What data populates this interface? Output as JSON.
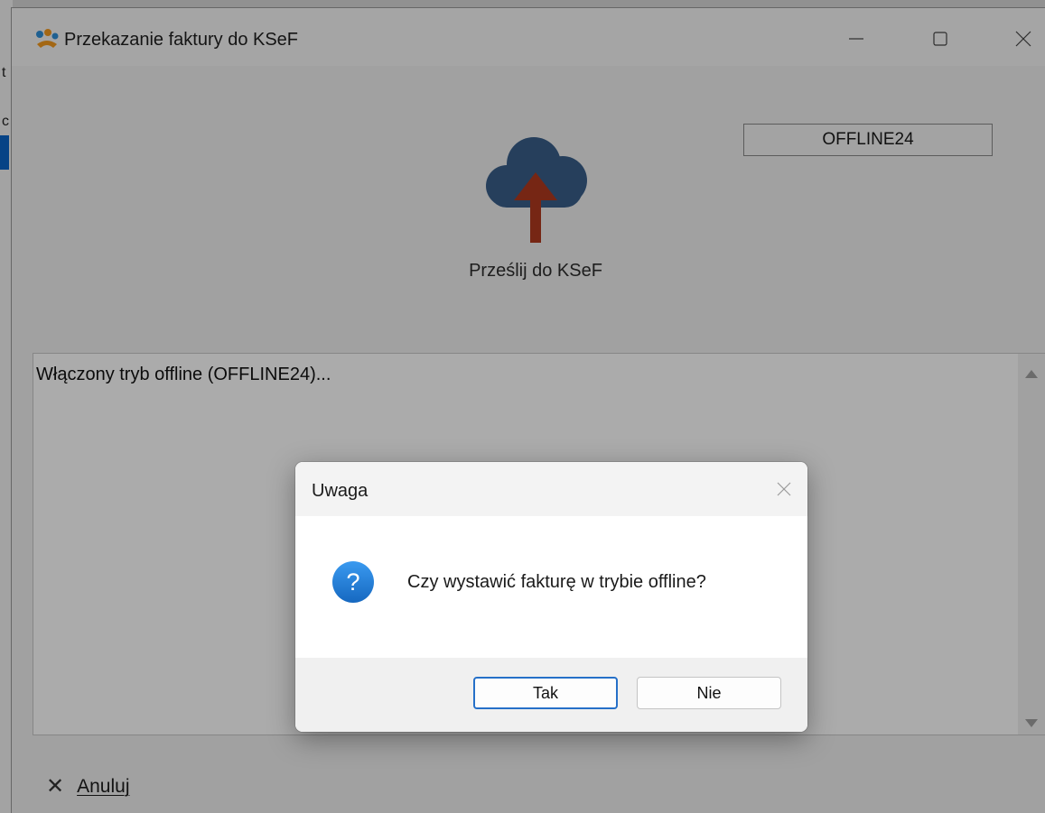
{
  "background_window": {
    "chars": [
      "t",
      "c"
    ]
  },
  "window": {
    "title": "Przekazanie faktury do KSeF",
    "app_icon": "app-logo-icon",
    "controls": {
      "minimize_icon": "minimize-icon",
      "maximize_icon": "maximize-icon",
      "close_icon": "close-icon"
    }
  },
  "mode_badge": "OFFLINE24",
  "upload": {
    "icon": "cloud-upload-icon",
    "label": "Prześlij  do KSeF"
  },
  "log": {
    "text": "Włączony tryb offline (OFFLINE24)..."
  },
  "footer": {
    "cancel_icon": "close-x-icon",
    "cancel_label": "Anuluj"
  },
  "dialog": {
    "title": "Uwaga",
    "icon": "question-icon",
    "message": "Czy wystawić fakturę w trybie offline?",
    "yes_label": "Tak",
    "no_label": "Nie"
  },
  "colors": {
    "cloud": "#3a5f8a",
    "arrow": "#b13a1f",
    "question_icon": "#1f7fd6",
    "default_button_border": "#2670c8"
  }
}
